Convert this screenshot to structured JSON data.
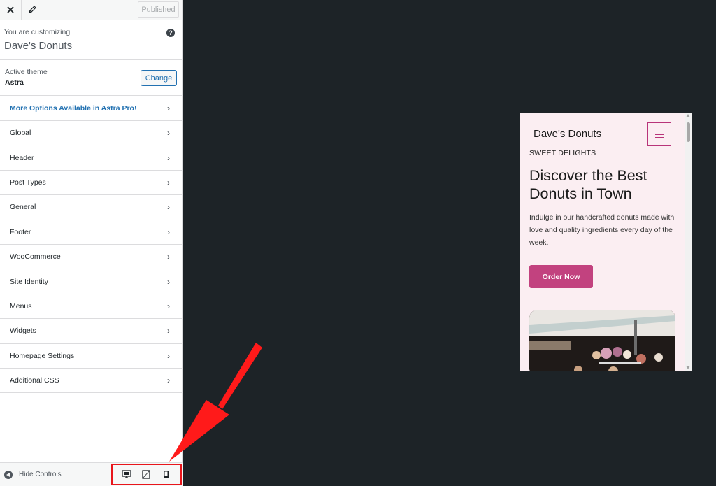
{
  "topbar": {
    "publish_label": "Published"
  },
  "header": {
    "customizing_label": "You are customizing",
    "site_name": "Dave's Donuts",
    "help_icon": "?"
  },
  "theme": {
    "label": "Active theme",
    "name": "Astra",
    "change_label": "Change"
  },
  "menu": {
    "items": [
      "More Options Available in Astra Pro!",
      "Global",
      "Header",
      "Post Types",
      "General",
      "Footer",
      "WooCommerce",
      "Site Identity",
      "Menus",
      "Widgets",
      "Homepage Settings",
      "Additional CSS"
    ],
    "chevron": "›"
  },
  "footer": {
    "hide_controls_label": "Hide Controls"
  },
  "devices": [
    "desktop-icon",
    "tablet-icon",
    "mobile-icon"
  ],
  "colors": {
    "accent": "#c2427f",
    "highlight": "#e8151b",
    "link": "#2271b1",
    "preview_bg": "#fbeef2",
    "canvas_bg": "#1d2327"
  },
  "preview": {
    "site_title": "Dave's Donuts",
    "eyebrow": "SWEET DELIGHTS",
    "heading": "Discover the Best Donuts in Town",
    "text": "Indulge in our handcrafted donuts made with love and quality ingredients every day of the week.",
    "button": "Order Now"
  }
}
